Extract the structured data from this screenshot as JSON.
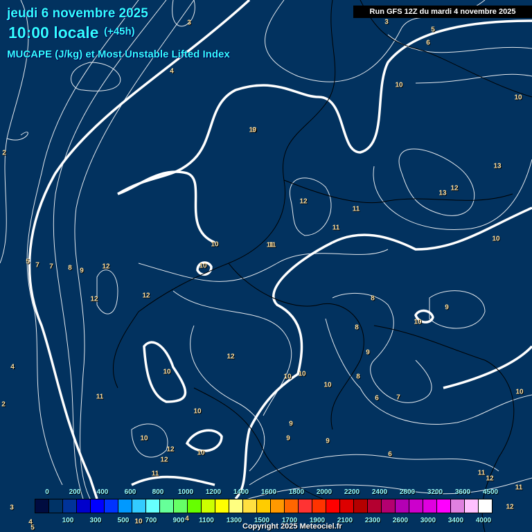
{
  "header": {
    "date": "jeudi 6 novembre 2025",
    "hour": "10:00 locale",
    "lead": "(+45h)",
    "parameter": "MUCAPE (J/kg) et Most Unstable Lifted Index",
    "run": "Run GFS 12Z du mardi 4 novembre 2025"
  },
  "legend": {
    "colors": [
      "#000c40",
      "#003366",
      "#003399",
      "#0000cc",
      "#0000ff",
      "#0033ff",
      "#0099ff",
      "#33ccff",
      "#66ffff",
      "#66ff99",
      "#66ff66",
      "#66ff00",
      "#ccff00",
      "#ffff00",
      "#ffff80",
      "#ffe040",
      "#ffcc00",
      "#ff9900",
      "#ff6600",
      "#ff3333",
      "#ff3300",
      "#ff0000",
      "#dd0000",
      "#b40000",
      "#b40030",
      "#b40070",
      "#b400b4",
      "#cc00cc",
      "#e000e0",
      "#ff00ff",
      "#e080e0",
      "#ffc0ff",
      "#ffffff"
    ],
    "top_labels": [
      "0",
      "200",
      "400",
      "600",
      "800",
      "1000",
      "1200",
      "1400",
      "1600",
      "1800",
      "2000",
      "2200",
      "2400",
      "2800",
      "3200",
      "3600",
      "4500"
    ],
    "bottom_labels": [
      "100",
      "300",
      "500",
      "700",
      "900",
      "1100",
      "1300",
      "1500",
      "1700",
      "1900",
      "2100",
      "2300",
      "2600",
      "3000",
      "3400",
      "4000"
    ]
  },
  "contour_labels": [
    "3",
    "4",
    "5",
    "6",
    "7",
    "8",
    "9",
    "10",
    "12",
    "12",
    "12",
    "10",
    "10",
    "11",
    "11",
    "12",
    "13",
    "13",
    "12",
    "10",
    "10",
    "10",
    "11",
    "12",
    "10",
    "8",
    "8",
    "9",
    "9",
    "10",
    "8",
    "6",
    "7",
    "10",
    "10",
    "9",
    "9",
    "9",
    "10",
    "12",
    "10",
    "12",
    "11",
    "11",
    "10",
    "6",
    "11",
    "12",
    "11",
    "12",
    "4",
    "2",
    "2",
    "3",
    "10",
    "9",
    "11",
    "10",
    "10",
    "3",
    "4",
    "5",
    "7",
    "5",
    "4"
  ],
  "copyright": "Copyright 2025 Meteociel.fr"
}
